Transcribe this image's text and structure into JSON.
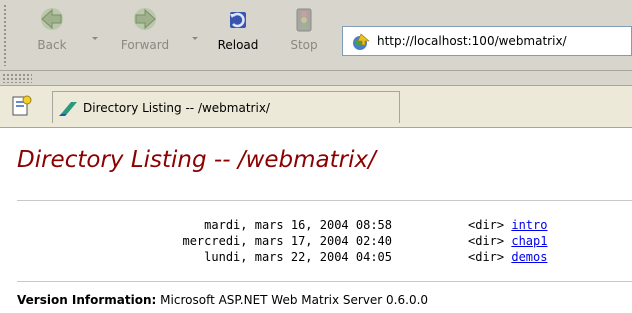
{
  "toolbar": {
    "back_label": "Back",
    "forward_label": "Forward",
    "reload_label": "Reload",
    "stop_label": "Stop"
  },
  "address_bar": {
    "url": "http://localhost:100/webmatrix/",
    "icon": "world-arrow-icon"
  },
  "tabs": [
    {
      "label": "Directory Listing -- /webmatrix/",
      "icon": "matrix-page-icon"
    }
  ],
  "page": {
    "title": "Directory Listing -- /webmatrix/",
    "title_color": "#8b0000",
    "link_color": "#0000ee",
    "entries": [
      {
        "date": "mardi, mars 16, 2004 08:58",
        "type": "<dir>",
        "name": "intro"
      },
      {
        "date": "mercredi, mars 17, 2004 02:40",
        "type": "<dir>",
        "name": "chap1"
      },
      {
        "date": "lundi, mars 22, 2004 04:05",
        "type": "<dir>",
        "name": "demos"
      }
    ],
    "version_label": "Version Information:",
    "version_text": "Microsoft ASP.NET Web Matrix Server 0.6.0.0"
  }
}
